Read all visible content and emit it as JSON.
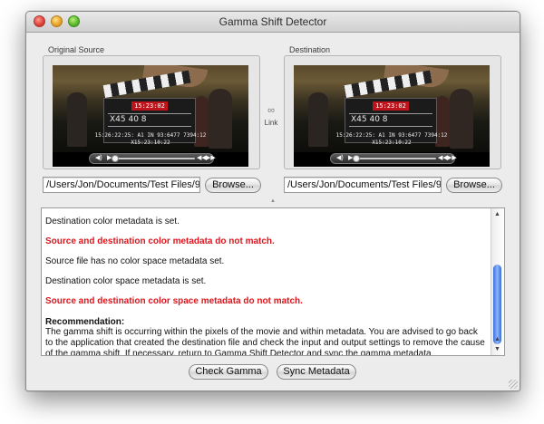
{
  "window": {
    "title": "Gamma Shift Detector"
  },
  "source": {
    "label": "Original Source",
    "path": "/Users/Jon/Documents/Test Files/9",
    "browse_label": "Browse..."
  },
  "destination": {
    "label": "Destination",
    "path": "/Users/Jon/Documents/Test Files/9",
    "browse_label": "Browse..."
  },
  "video": {
    "timecode": "15:23:02",
    "overlay_line1": "15:26:22:25: A1   IN 93:6477  7394:12",
    "overlay_line2": "X15:23:10:22",
    "slate_text": "X45 40 8"
  },
  "link": {
    "label": "Link",
    "icon": "chain-link-icon"
  },
  "log": {
    "lines": [
      {
        "text": "Destination color metadata is set.",
        "style": "normal"
      },
      {
        "text": "Source and destination color metadata do not match.",
        "style": "error"
      },
      {
        "text": "Source file has no color space metadata set.",
        "style": "normal"
      },
      {
        "text": "Destination color space metadata is set.",
        "style": "normal"
      },
      {
        "text": "Source and destination color space metadata do not match.",
        "style": "error"
      }
    ],
    "recommendation_heading": "Recommendation:",
    "recommendation_body": "The gamma shift is occurring within the pixels of the movie and within metadata. You are advised to go back to the application that created the destination file and check the input and output settings to remove the cause of the gamma shift. If necessary, return to Gamma Shift Detector and sync the gamma metadata."
  },
  "actions": {
    "check_gamma": "Check Gamma",
    "sync_metadata": "Sync Metadata"
  },
  "colors": {
    "error_text": "#e0141c",
    "scroll_thumb": "#3a6fd8"
  }
}
